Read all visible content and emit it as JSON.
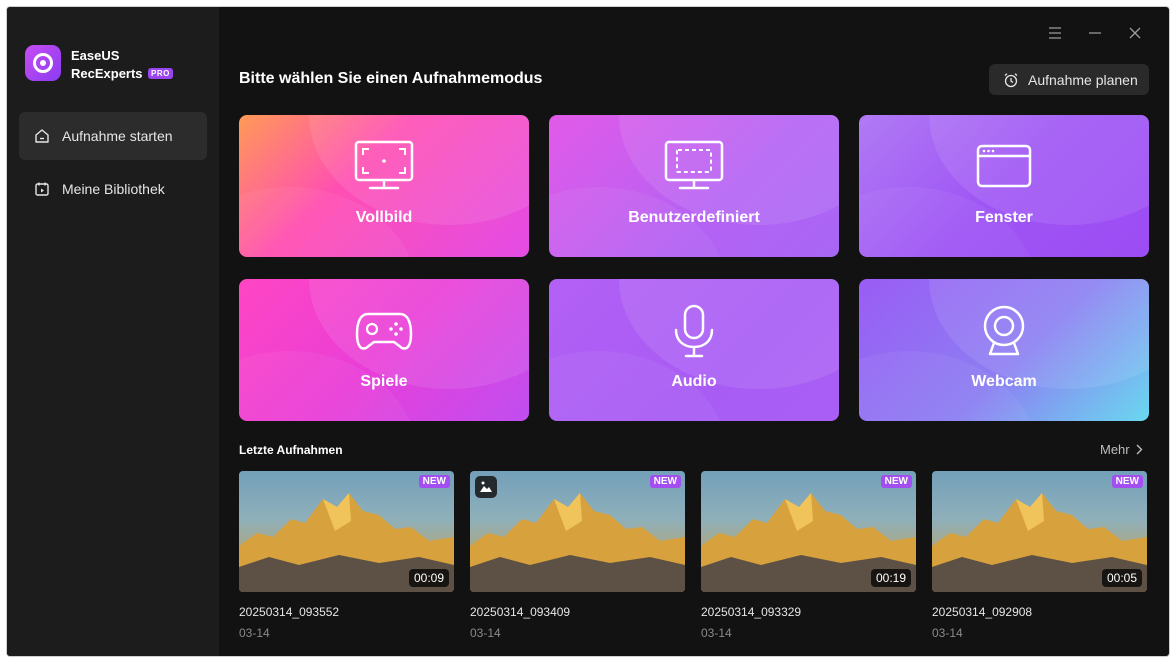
{
  "app": {
    "brand_line1": "EaseUS",
    "brand_line2": "RecExperts",
    "pro_badge": "PRO"
  },
  "sidebar": {
    "items": [
      {
        "label": "Aufnahme starten",
        "icon": "home-icon",
        "active": true
      },
      {
        "label": "Meine Bibliothek",
        "icon": "library-icon",
        "active": false
      }
    ]
  },
  "header": {
    "title": "Bitte wählen Sie einen Aufnahmemodus",
    "plan_button": "Aufnahme planen"
  },
  "modes": [
    {
      "label": "Vollbild",
      "icon": "fullscreen-monitor-icon"
    },
    {
      "label": "Benutzerdefiniert",
      "icon": "custom-region-monitor-icon"
    },
    {
      "label": "Fenster",
      "icon": "window-icon"
    },
    {
      "label": "Spiele",
      "icon": "gamepad-icon"
    },
    {
      "label": "Audio",
      "icon": "microphone-icon"
    },
    {
      "label": "Webcam",
      "icon": "webcam-icon"
    }
  ],
  "recent": {
    "title": "Letzte Aufnahmen",
    "more_label": "Mehr",
    "items": [
      {
        "name": "20250314_093552",
        "date": "03-14",
        "duration": "00:09",
        "badge": "NEW",
        "is_image": false
      },
      {
        "name": "20250314_093409",
        "date": "03-14",
        "duration": "",
        "badge": "NEW",
        "is_image": true
      },
      {
        "name": "20250314_093329",
        "date": "03-14",
        "duration": "00:19",
        "badge": "NEW",
        "is_image": false
      },
      {
        "name": "20250314_092908",
        "date": "03-14",
        "duration": "00:05",
        "badge": "NEW",
        "is_image": false
      }
    ]
  },
  "colors": {
    "background": "#121212",
    "sidebar": "#1c1c1c",
    "accent": "#a24ef0"
  }
}
